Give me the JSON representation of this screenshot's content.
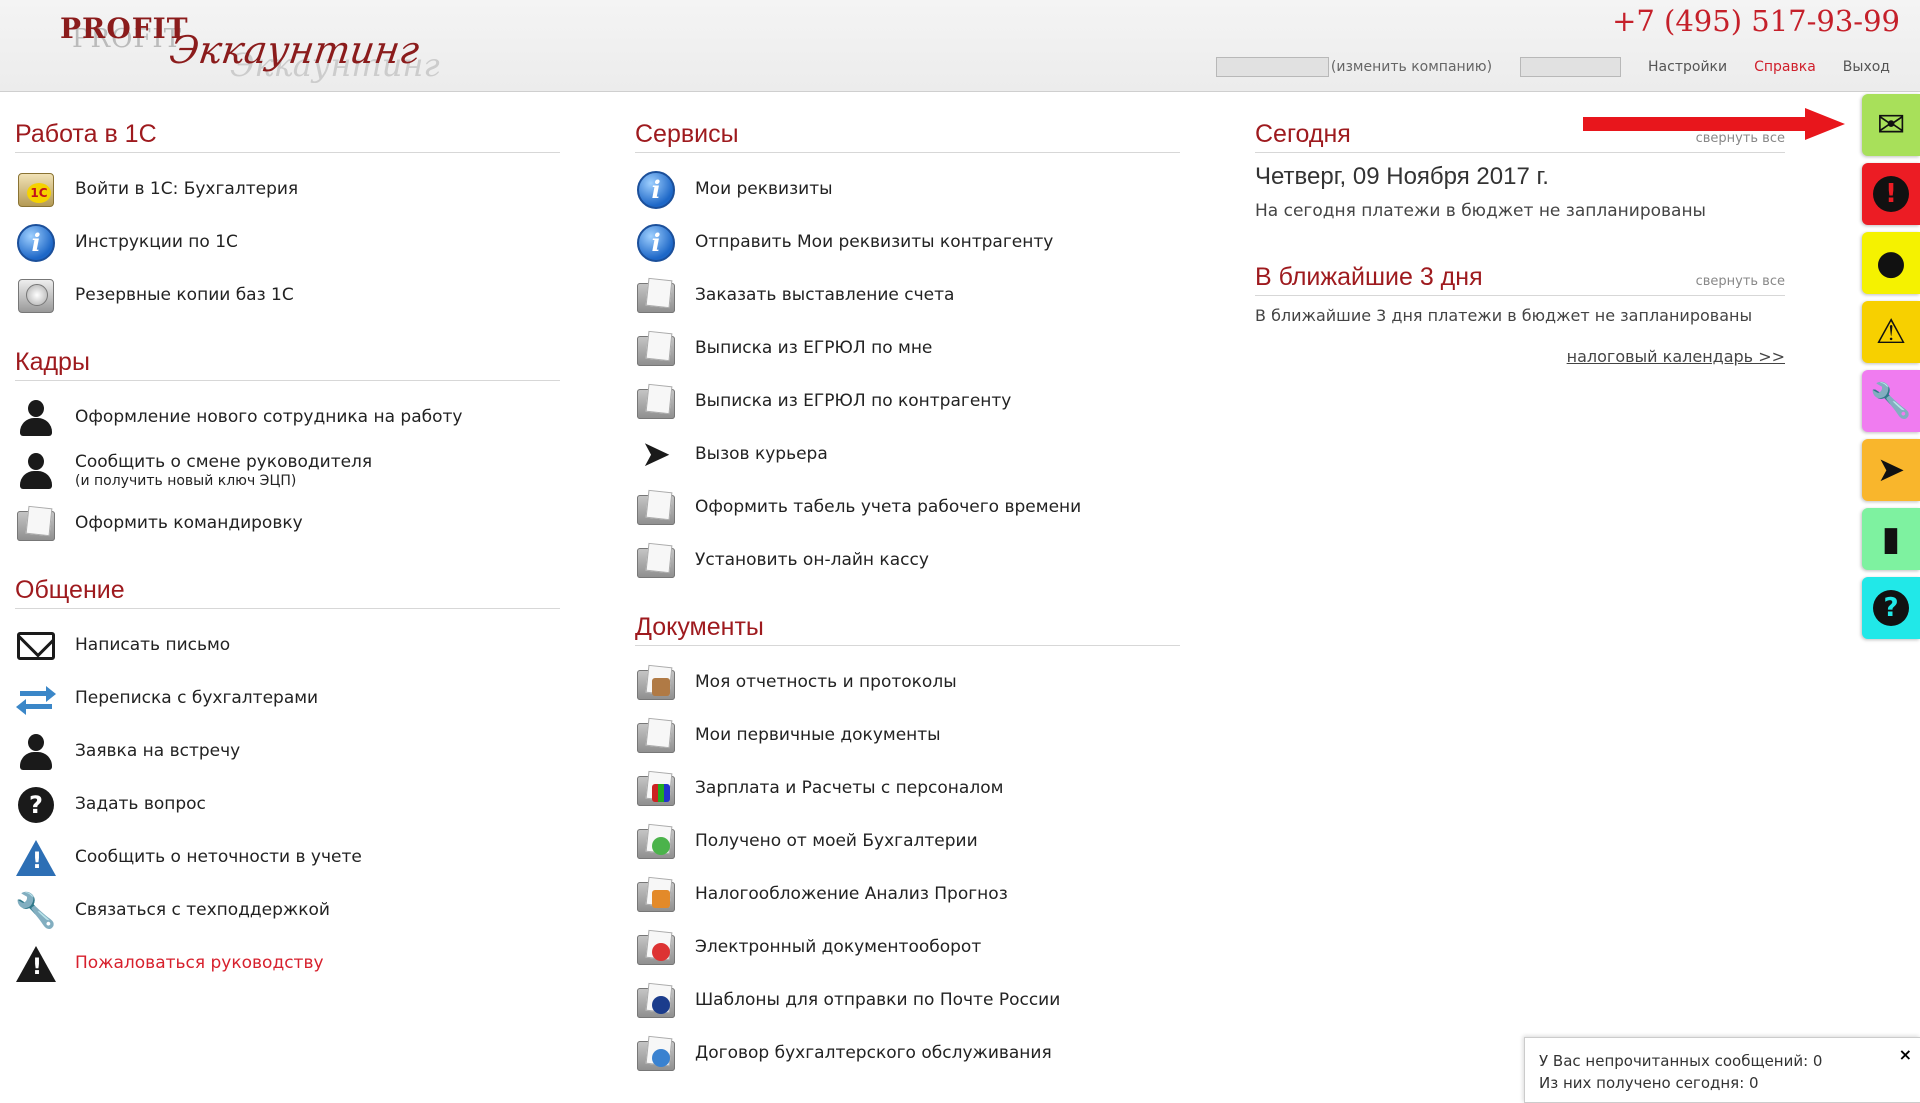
{
  "header": {
    "logo_latin": "PROFIT",
    "logo_cyrillic": "Эккаунтинг",
    "phone": "+7 (495) 517-93-99",
    "change_company": "(изменить компанию)",
    "settings": "Настройки",
    "help": "Справка",
    "logout": "Выход"
  },
  "work1c": {
    "title": "Работа в 1С",
    "items": [
      {
        "label": "Войти в 1С: Бухгалтерия",
        "icon": "1c-icon"
      },
      {
        "label": "Инструкции по 1С",
        "icon": "info-icon"
      },
      {
        "label": "Резервные копии баз 1С",
        "icon": "hdd-icon"
      }
    ]
  },
  "staff": {
    "title": "Кадры",
    "items": [
      {
        "label": "Оформление нового сотрудника на работу",
        "icon": "person-icon"
      },
      {
        "label": "Сообщить о смене руководителя",
        "sub": "(и получить новый ключ ЭЦП)",
        "icon": "person-icon"
      },
      {
        "label": "Оформить командировку",
        "icon": "folder-icon"
      }
    ]
  },
  "comm": {
    "title": "Общение",
    "items": [
      {
        "label": "Написать письмо",
        "icon": "mail-icon"
      },
      {
        "label": "Переписка с бухгалтерами",
        "icon": "arrows-icon"
      },
      {
        "label": "Заявка на встречу",
        "icon": "person-icon"
      },
      {
        "label": "Задать вопрос",
        "icon": "question-icon"
      },
      {
        "label": "Сообщить о неточности в учете",
        "icon": "warning-icon"
      },
      {
        "label": "Связаться с техподдержкой",
        "icon": "wrench-icon"
      },
      {
        "label": "Пожаловаться руководству",
        "icon": "warning-icon"
      }
    ]
  },
  "services": {
    "title": "Сервисы",
    "items": [
      {
        "label": "Мои реквизиты",
        "icon": "info-icon"
      },
      {
        "label": "Отправить Мои реквизиты контрагенту",
        "icon": "info-icon"
      },
      {
        "label": "Заказать выставление счета",
        "icon": "folder-icon"
      },
      {
        "label": "Выписка из ЕГРЮЛ по мне",
        "icon": "folder-icon"
      },
      {
        "label": "Выписка из ЕГРЮЛ по контрагенту",
        "icon": "folder-icon"
      },
      {
        "label": "Вызов курьера",
        "icon": "paper-plane-icon"
      },
      {
        "label": "Оформить табель учета рабочего времени",
        "icon": "folder-icon"
      },
      {
        "label": "Установить он-лайн кассу",
        "icon": "folder-icon"
      }
    ]
  },
  "docs": {
    "title": "Документы",
    "items": [
      {
        "label": "Моя отчетность и протоколы",
        "icon": "folder-box-icon"
      },
      {
        "label": "Мои первичные документы",
        "icon": "folder-icon"
      },
      {
        "label": "Зарплата и Расчеты с персоналом",
        "icon": "folder-books-icon"
      },
      {
        "label": "Получено от моей Бухгалтерии",
        "icon": "folder-download-icon"
      },
      {
        "label": "Налогообложение Анализ Прогноз",
        "icon": "folder-chart-icon"
      },
      {
        "label": "Электронный документооборот",
        "icon": "folder-sync-icon"
      },
      {
        "label": "Шаблоны для отправки по Почте России",
        "icon": "folder-post-icon"
      },
      {
        "label": "Договор бухгалтерского обслуживания",
        "icon": "folder-globe-icon"
      }
    ]
  },
  "today": {
    "title": "Сегодня",
    "collapse": "свернуть все",
    "date": "Четверг, 09 Ноября 2017 г.",
    "note": "На сегодня платежи в бюджет не запланированы"
  },
  "near": {
    "title": "В ближайшие 3 дня",
    "collapse": "свернуть все",
    "note": "В ближайшие 3 дня платежи в бюджет не запланированы",
    "tax_link": "налоговый календарь >>"
  },
  "side_tabs": [
    {
      "name": "mail-icon",
      "color": "#a8e05a",
      "glyph": "✉"
    },
    {
      "name": "alert-icon",
      "color": "#ec1c24",
      "glyph": "!"
    },
    {
      "name": "person-icon",
      "color": "#f5f200",
      "glyph": "●"
    },
    {
      "name": "warning-icon",
      "color": "#f7d000",
      "glyph": "⚠"
    },
    {
      "name": "wrench-icon",
      "color": "#f07cf0",
      "glyph": "🔧"
    },
    {
      "name": "paper-plane-icon",
      "color": "#f9b62c",
      "glyph": "➤"
    },
    {
      "name": "bookmark-icon",
      "color": "#7ef2a0",
      "glyph": "▮"
    },
    {
      "name": "question-icon",
      "color": "#21e8e8",
      "glyph": "?"
    }
  ],
  "notification": {
    "unread": "У Вас непрочитанных сообщений: 0",
    "today": "Из них получено сегодня: 0",
    "close": "×"
  }
}
